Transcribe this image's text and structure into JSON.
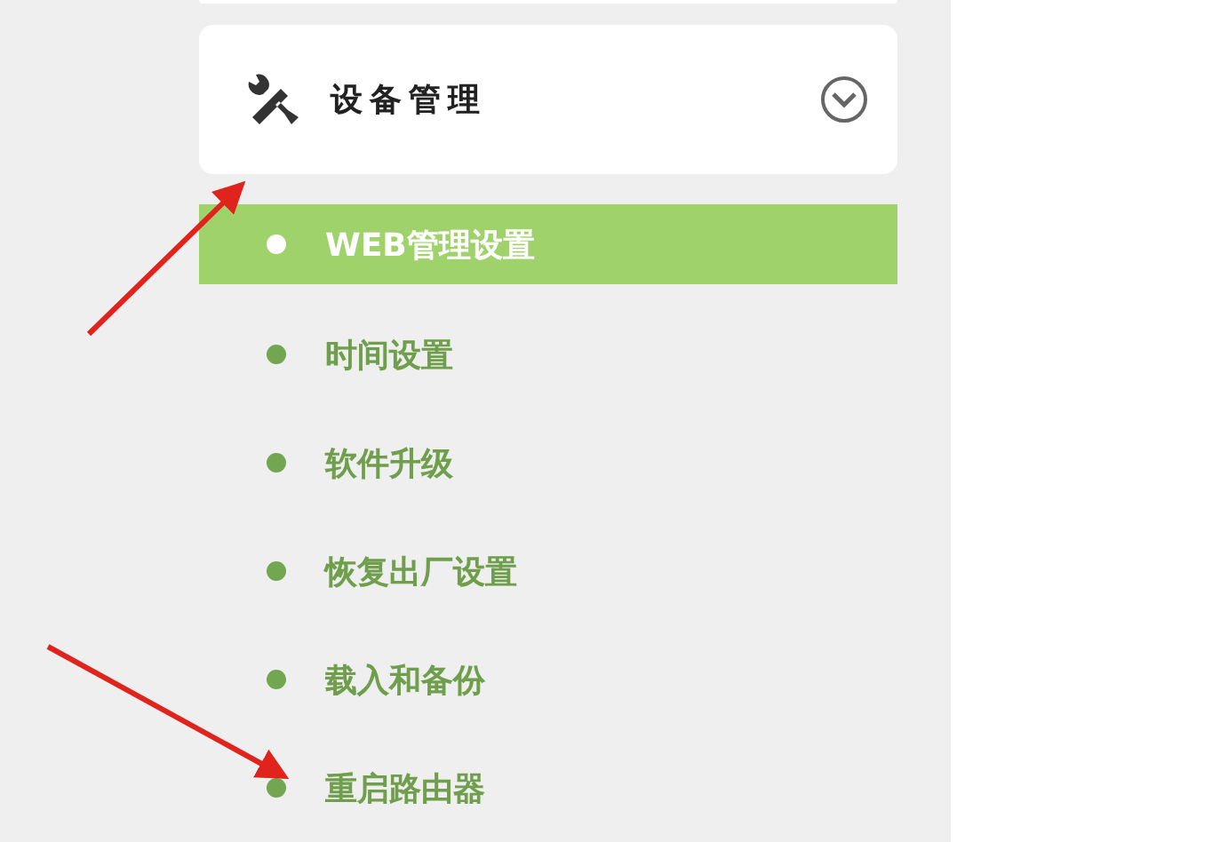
{
  "menu_group": {
    "title": "设备管理",
    "expanded": true
  },
  "items": [
    {
      "label": "WEB管理设置",
      "selected": true
    },
    {
      "label": "时间设置",
      "selected": false
    },
    {
      "label": "软件升级",
      "selected": false
    },
    {
      "label": "恢复出厂设置",
      "selected": false
    },
    {
      "label": "载入和备份",
      "selected": false
    },
    {
      "label": "重启路由器",
      "selected": false
    }
  ]
}
